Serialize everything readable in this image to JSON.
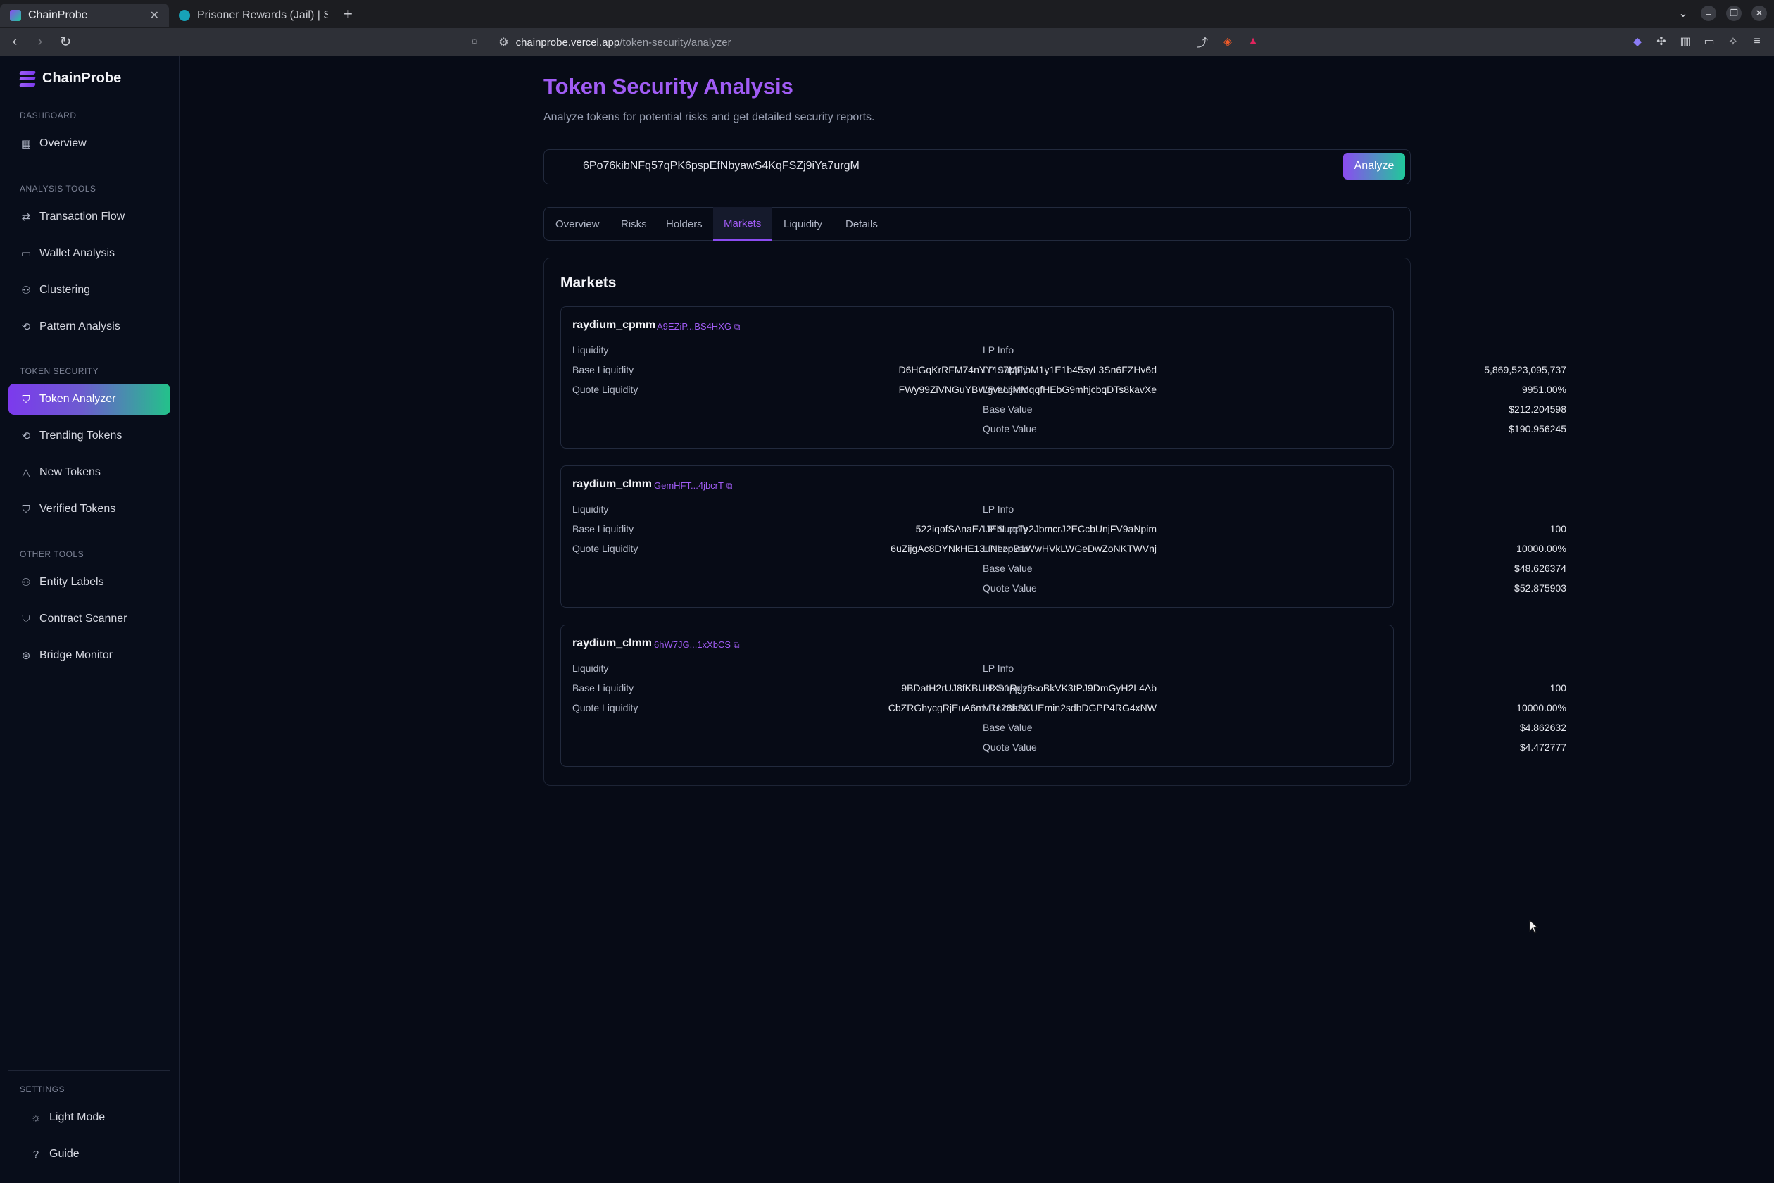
{
  "browser": {
    "tabs": [
      {
        "title": "ChainProbe",
        "active": true
      },
      {
        "title": "Prisoner Rewards (Jail) | Sol",
        "active": false
      }
    ],
    "url_host": "chainprobe.vercel.app",
    "url_path": "/token-security/analyzer"
  },
  "sidebar": {
    "brand": "ChainProbe",
    "sections": {
      "dashboard": "DASHBOARD",
      "analysis": "ANALYSIS TOOLS",
      "token": "TOKEN SECURITY",
      "other": "OTHER TOOLS",
      "settings": "SETTINGS"
    },
    "items": {
      "overview": "Overview",
      "transaction_flow": "Transaction Flow",
      "wallet_analysis": "Wallet Analysis",
      "clustering": "Clustering",
      "pattern_analysis": "Pattern Analysis",
      "token_analyzer": "Token Analyzer",
      "trending_tokens": "Trending Tokens",
      "new_tokens": "New Tokens",
      "verified_tokens": "Verified Tokens",
      "entity_labels": "Entity Labels",
      "contract_scanner": "Contract Scanner",
      "bridge_monitor": "Bridge Monitor",
      "light_mode": "Light Mode",
      "guide": "Guide"
    }
  },
  "page": {
    "title": "Token Security Analysis",
    "subtitle": "Analyze tokens for potential risks and get detailed security reports.",
    "search_value": "6Po76kibNFq57qPK6pspEfNbyawS4KqFSZj9iYa7urgM",
    "analyze_label": "Analyze",
    "tabs": [
      "Overview",
      "Risks",
      "Holders",
      "Markets",
      "Liquidity",
      "Details"
    ],
    "active_tab": "Markets",
    "panel_title": "Markets"
  },
  "labels": {
    "liquidity": "Liquidity",
    "base_liquidity": "Base Liquidity",
    "quote_liquidity": "Quote Liquidity",
    "lp_info": "LP Info",
    "lp_supply": "LP Supply",
    "lp_locked": "LP Locked",
    "base_value": "Base Value",
    "quote_value": "Quote Value"
  },
  "markets": [
    {
      "name": "raydium_cpmm",
      "address": "A9EZiP...BS4HXG",
      "base_liquidity": "D6HGqKrRFM74nYY197MFibM1y1E1b45syL3Sn6FZHv6d",
      "quote_liquidity": "FWy99ZiVNGuYBWgvaUjMMqqfHEbG9mhjcbqDTs8kavXe",
      "lp_supply": "5,869,523,095,737",
      "lp_locked": "9951.00%",
      "base_value": "$212.204598",
      "quote_value": "$190.956245"
    },
    {
      "name": "raydium_clmm",
      "address": "GemHFT...4jbcrT",
      "base_liquidity": "522iqofSAnaEAJEhLocTy2JbmcrJ2ECcbUnjFV9aNpim",
      "quote_liquidity": "6uZijgAc8DYNkHE13uNezpB1WwHVkLWGeDwZoNKTWVnj",
      "lp_supply": "100",
      "lp_locked": "10000.00%",
      "base_value": "$48.626374",
      "quote_value": "$52.875903"
    },
    {
      "name": "raydium_clmm",
      "address": "6hW7JG...1xXbCS",
      "base_liquidity": "9BDatH2rUJ8fKBUHXb1Rgz6soBkVK3tPJ9DmGyH2L4Ab",
      "quote_liquidity": "CbZRGhycgRjEuA6mvRc28bSXUEmin2sdbDGPP4RG4xNW",
      "lp_supply": "100",
      "lp_locked": "10000.00%",
      "base_value": "$4.862632",
      "quote_value": "$4.472777"
    }
  ],
  "colors": {
    "accent": "#a15cf5",
    "accent_green": "#20c99a",
    "background": "#070b16"
  }
}
